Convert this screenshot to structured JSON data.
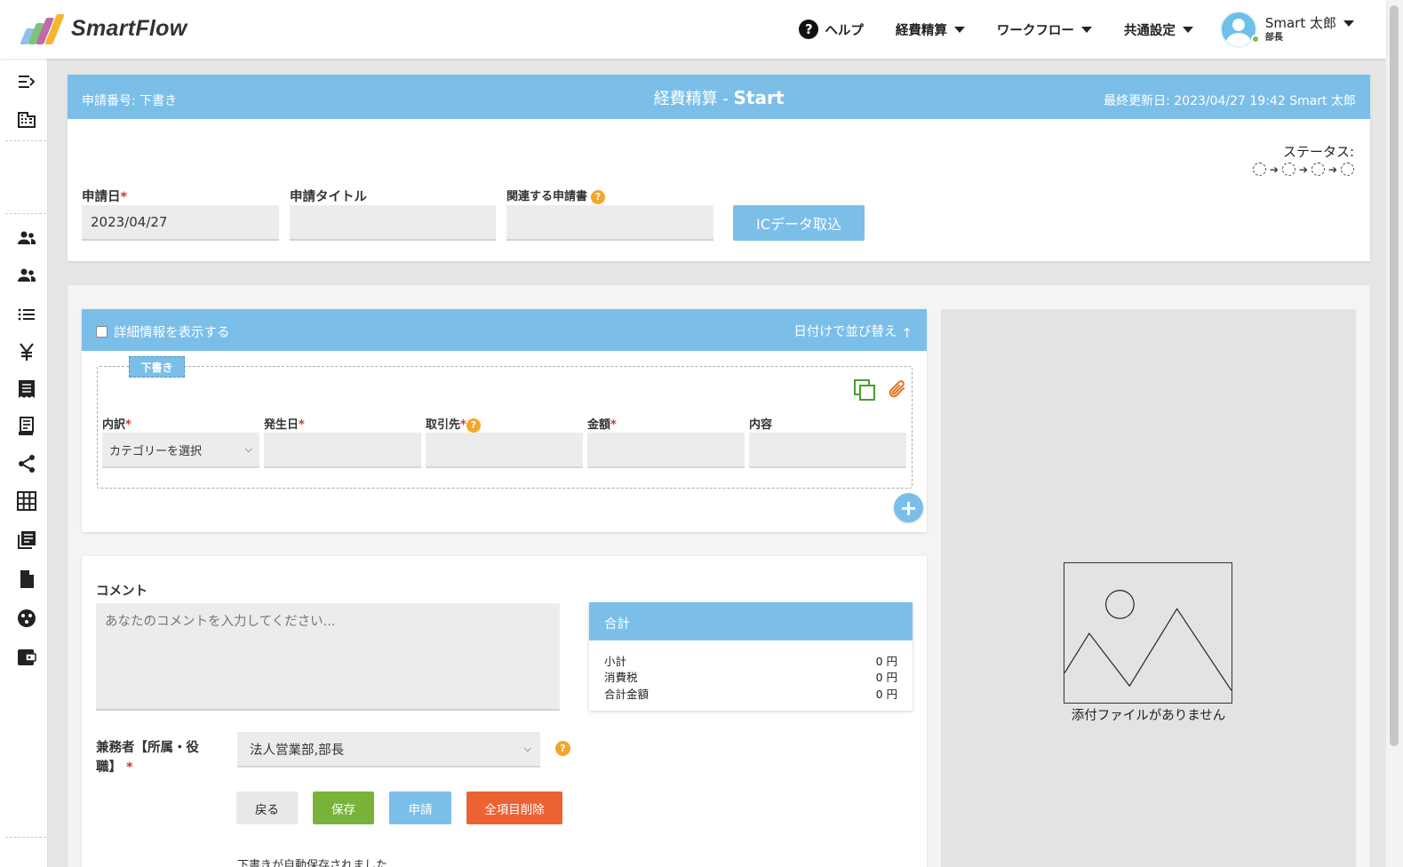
{
  "app": {
    "logo_text": "SmartFlow"
  },
  "nav": {
    "help": "ヘルプ",
    "expense": "経費精算",
    "workflow": "ワークフロー",
    "common": "共通設定",
    "user_name": "Smart 太郎",
    "user_role": "部長"
  },
  "sidebar": {
    "icons": [
      "menu-expand-icon",
      "building-icon",
      "users-icon",
      "users-group-icon",
      "list-icon",
      "yen-icon",
      "receipt-icon",
      "receipt-long-icon",
      "share-icon",
      "grid-icon",
      "library-books-icon",
      "file-icon",
      "palette-icon",
      "wallet-icon"
    ]
  },
  "header": {
    "app_no": "申請番号: 下書き",
    "title": "経費精算 - ",
    "title_bold": "Start",
    "last_updated": "最終更新日: 2023/04/27 19:42 Smart 太郎",
    "status_label": "ステータス:",
    "status_steps": 4
  },
  "form": {
    "date_label": "申請日",
    "date_value": "2023/04/27",
    "title_label": "申請タイトル",
    "title_value": "",
    "related_label": "関連する申請書",
    "related_value": "",
    "ic_button": "ICデータ取込"
  },
  "detail": {
    "show_details": "詳細情報を表示する",
    "sort_by_date": "日付けで並び替え",
    "draft_tag": "下書き",
    "columns": {
      "category": "内訳",
      "date": "発生日",
      "vendor": "取引先",
      "amount": "金額",
      "content": "内容"
    },
    "category_placeholder": "カテゴリーを選択"
  },
  "comment": {
    "label": "コメント",
    "placeholder": "あなたのコメントを入力してください..."
  },
  "totals": {
    "header": "合計",
    "rows": [
      {
        "label": "小計",
        "value": "0 円"
      },
      {
        "label": "消費税",
        "value": "0 円"
      },
      {
        "label": "合計金額",
        "value": "0 円"
      }
    ]
  },
  "approver": {
    "label": "兼務者【所属・役職】",
    "value": "法人営業部,部長"
  },
  "buttons": {
    "back": "戻る",
    "save": "保存",
    "apply": "申請",
    "clear_all": "全項目削除"
  },
  "autosave_note": "下書きが自動保存されました",
  "attachment": {
    "empty_text": "添付ファイルがありません"
  },
  "colors": {
    "primary": "#7bbfe9",
    "save": "#79b33a",
    "danger": "#ec6233",
    "required": "#d9312b",
    "help": "#f4a62a",
    "online": "#7ac143"
  }
}
